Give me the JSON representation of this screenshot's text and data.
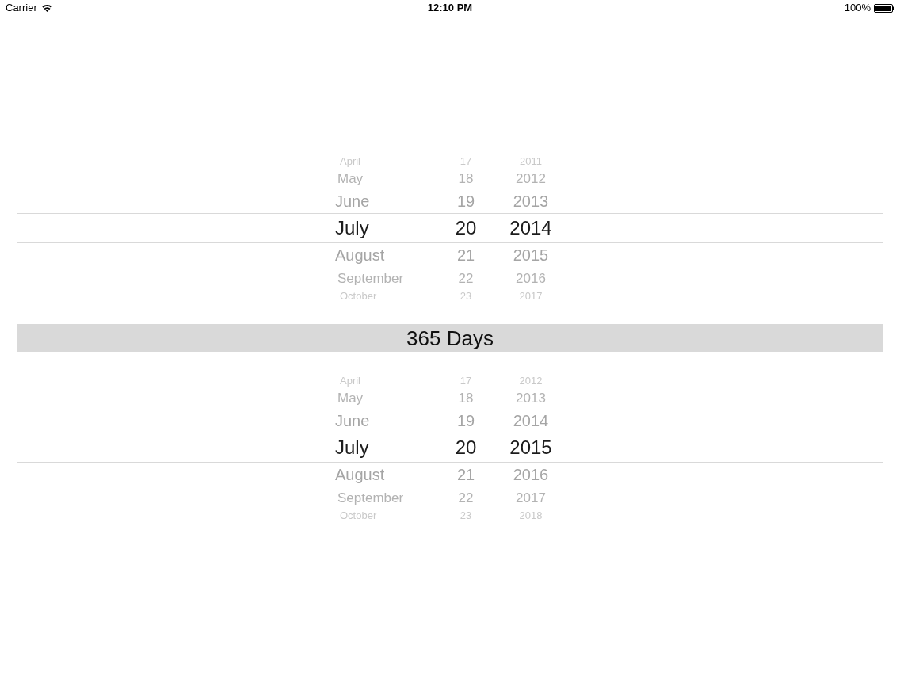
{
  "status_bar": {
    "carrier": "Carrier",
    "time": "12:10 PM",
    "battery": "100%"
  },
  "pickers": [
    {
      "columns": [
        {
          "kind": "month",
          "items": [
            {
              "label": "April",
              "selected": false
            },
            {
              "label": "May",
              "selected": false
            },
            {
              "label": "June",
              "selected": false
            },
            {
              "label": "July",
              "selected": true
            },
            {
              "label": "August",
              "selected": false
            },
            {
              "label": "September",
              "selected": false
            },
            {
              "label": "October",
              "selected": false
            }
          ]
        },
        {
          "kind": "day",
          "items": [
            {
              "label": "17",
              "selected": false
            },
            {
              "label": "18",
              "selected": false
            },
            {
              "label": "19",
              "selected": false
            },
            {
              "label": "20",
              "selected": true
            },
            {
              "label": "21",
              "selected": false
            },
            {
              "label": "22",
              "selected": false
            },
            {
              "label": "23",
              "selected": false
            }
          ]
        },
        {
          "kind": "year",
          "items": [
            {
              "label": "2011",
              "selected": false
            },
            {
              "label": "2012",
              "selected": false
            },
            {
              "label": "2013",
              "selected": false
            },
            {
              "label": "2014",
              "selected": true
            },
            {
              "label": "2015",
              "selected": false
            },
            {
              "label": "2016",
              "selected": false
            },
            {
              "label": "2017",
              "selected": false
            }
          ]
        }
      ]
    },
    {
      "columns": [
        {
          "kind": "month",
          "items": [
            {
              "label": "April",
              "selected": false
            },
            {
              "label": "May",
              "selected": false
            },
            {
              "label": "June",
              "selected": false
            },
            {
              "label": "July",
              "selected": true
            },
            {
              "label": "August",
              "selected": false
            },
            {
              "label": "September",
              "selected": false
            },
            {
              "label": "October",
              "selected": false
            }
          ]
        },
        {
          "kind": "day",
          "items": [
            {
              "label": "17",
              "selected": false
            },
            {
              "label": "18",
              "selected": false
            },
            {
              "label": "19",
              "selected": false
            },
            {
              "label": "20",
              "selected": true
            },
            {
              "label": "21",
              "selected": false
            },
            {
              "label": "22",
              "selected": false
            },
            {
              "label": "23",
              "selected": false
            }
          ]
        },
        {
          "kind": "year",
          "items": [
            {
              "label": "2012",
              "selected": false
            },
            {
              "label": "2013",
              "selected": false
            },
            {
              "label": "2014",
              "selected": false
            },
            {
              "label": "2015",
              "selected": true
            },
            {
              "label": "2016",
              "selected": false
            },
            {
              "label": "2017",
              "selected": false
            },
            {
              "label": "2018",
              "selected": false
            }
          ]
        }
      ]
    }
  ],
  "duration": {
    "label": "365 Days"
  }
}
